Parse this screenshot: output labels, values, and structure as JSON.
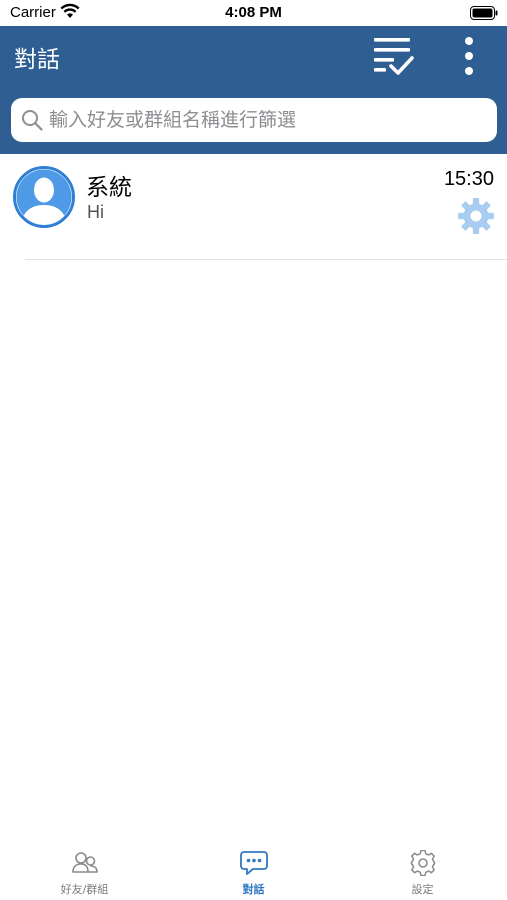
{
  "status_bar": {
    "carrier": "Carrier",
    "time": "4:08 PM"
  },
  "nav": {
    "title": "對話",
    "icons": [
      "filter-check-icon",
      "more-vert-icon"
    ]
  },
  "search": {
    "placeholder": "輸入好友或群組名稱進行篩選",
    "value": ""
  },
  "conversations": [
    {
      "name": "系統",
      "last_message": "Hi",
      "time": "15:30",
      "avatar_icon": "person-avatar-icon",
      "badge_icon": "gear-icon"
    }
  ],
  "tabs": [
    {
      "label": "好友/群組",
      "icon": "contacts-icon",
      "active": false
    },
    {
      "label": "對話",
      "icon": "chat-bubble-icon",
      "active": true
    },
    {
      "label": "設定",
      "icon": "settings-gear-icon",
      "active": false
    }
  ],
  "colors": {
    "header_bg": "#2f5e92",
    "accent": "#2f78c4",
    "avatar_blue": "#3d8ee0",
    "gear_light": "#a9cdf0",
    "tab_inactive": "#7a7a7a"
  }
}
